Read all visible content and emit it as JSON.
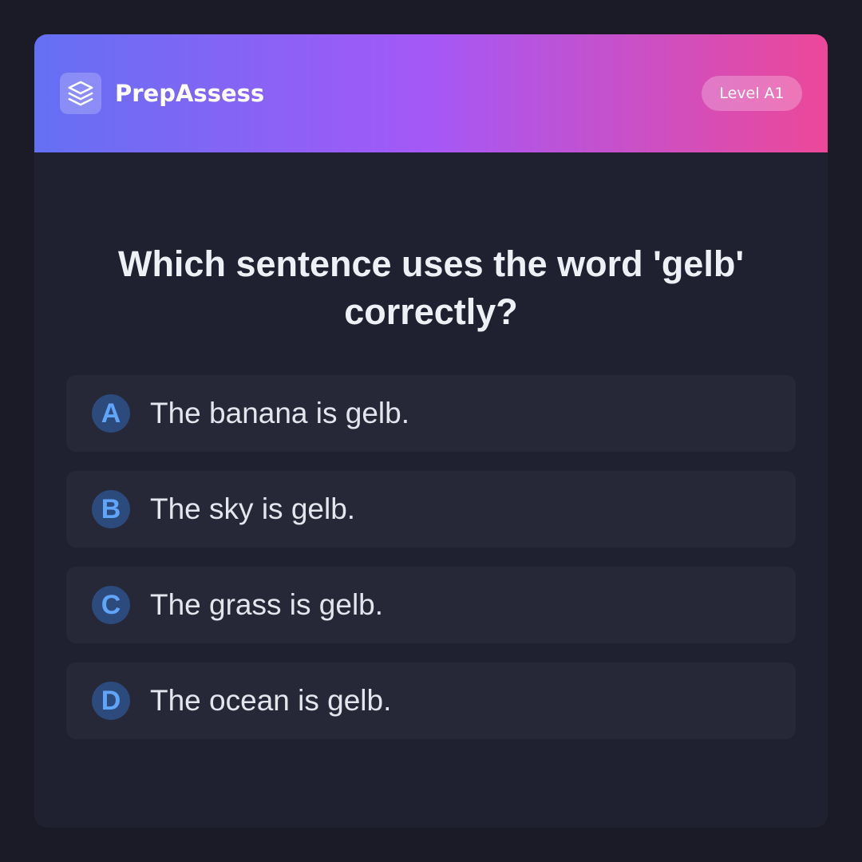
{
  "app": {
    "brand_name": "PrepAssess",
    "logo_icon": "layers-icon",
    "level_label": "Level A1"
  },
  "question": {
    "text": "Which sentence uses the word 'gelb' correctly?"
  },
  "options": [
    {
      "letter": "A",
      "text": "The banana is gelb."
    },
    {
      "letter": "B",
      "text": "The sky is gelb."
    },
    {
      "letter": "C",
      "text": "The grass is gelb."
    },
    {
      "letter": "D",
      "text": "The ocean is gelb."
    }
  ],
  "colors": {
    "background": "#1a1b26",
    "card": "#1f2130",
    "option_background": "#262837",
    "header_gradient": [
      "#6470f4",
      "#a558f6",
      "#ec4899"
    ],
    "letter_badge_background": "#2c4a7c",
    "letter_badge_text": "#60a5fa"
  }
}
